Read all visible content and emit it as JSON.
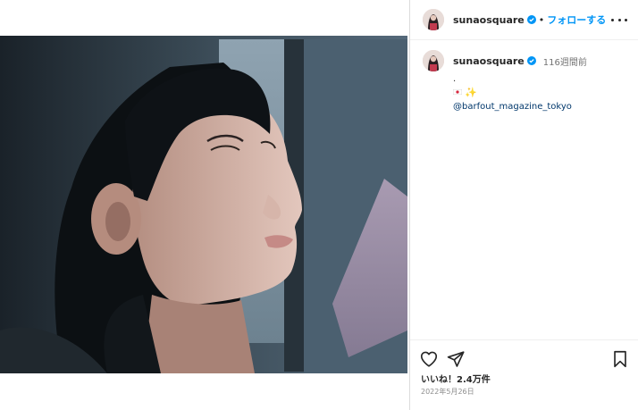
{
  "post": {
    "username": "sunaosquare",
    "follow_label": "フォローする",
    "separator": "•",
    "caption": {
      "time_ago": "116週間前",
      "line1": ".",
      "sparkle": "✨",
      "mention": "@barfout_magazine_tokyo"
    },
    "likes": "いいね！2.4万件",
    "date": "2022年5月26日"
  },
  "icons": {
    "more": "more-horizontal-icon",
    "like": "heart-icon",
    "share": "paper-plane-icon",
    "save": "bookmark-icon",
    "verified": "verified-badge-icon",
    "flag": "japan-flag-emoji",
    "sparkle": "sparkles-emoji"
  },
  "colors": {
    "link_blue": "#0095f6",
    "verified_blue": "#0095f6",
    "mention_color": "#00376b",
    "muted_text": "#737373"
  }
}
